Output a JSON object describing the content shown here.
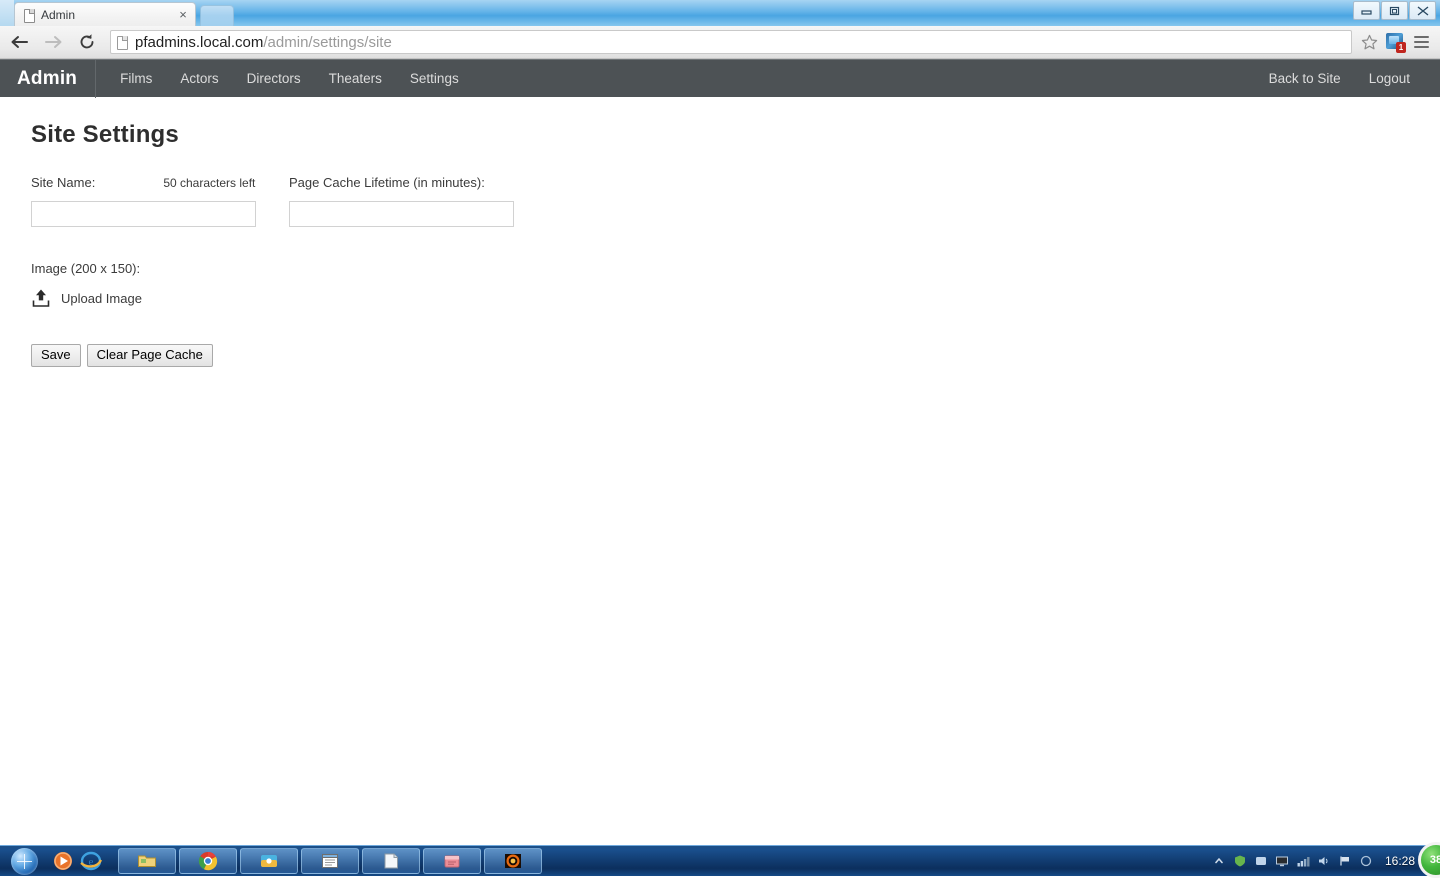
{
  "browser": {
    "tab": {
      "title": "Admin",
      "close_label": "×",
      "favicon": "page-icon"
    },
    "new_tab_label": "",
    "back_label": "←",
    "forward_label": "→",
    "reload_label": "C",
    "url_domain": "pfadmins.local.com",
    "url_path": "/admin/settings/site",
    "star_label": "☆",
    "extension_badge": "1",
    "window_controls": {
      "minimize": "—",
      "restore": "❐",
      "close": "✕"
    }
  },
  "navbar": {
    "brand": "Admin",
    "links": [
      {
        "label": "Films"
      },
      {
        "label": "Actors"
      },
      {
        "label": "Directors"
      },
      {
        "label": "Theaters"
      },
      {
        "label": "Settings"
      }
    ],
    "right_links": [
      {
        "label": "Back to Site"
      },
      {
        "label": "Logout"
      }
    ]
  },
  "page": {
    "title": "Site Settings",
    "site_name": {
      "label": "Site Name:",
      "characters_left": "50 characters left",
      "value": "",
      "placeholder": ""
    },
    "page_cache": {
      "label": "Page Cache Lifetime (in minutes):",
      "value": "",
      "placeholder": ""
    },
    "image": {
      "label": "Image (200 x 150):",
      "upload_label": "Upload Image",
      "upload_icon": "upload-icon"
    },
    "buttons": {
      "save": "Save",
      "clear_cache": "Clear Page Cache"
    }
  },
  "taskbar": {
    "start_label": "",
    "clock": "16:28",
    "badge": "38"
  },
  "colors": {
    "navbar_bg": "#4d5255",
    "page_title": "#2e2e2e",
    "taskbar_bg": "#10396c",
    "accent_green": "#41b63c"
  }
}
